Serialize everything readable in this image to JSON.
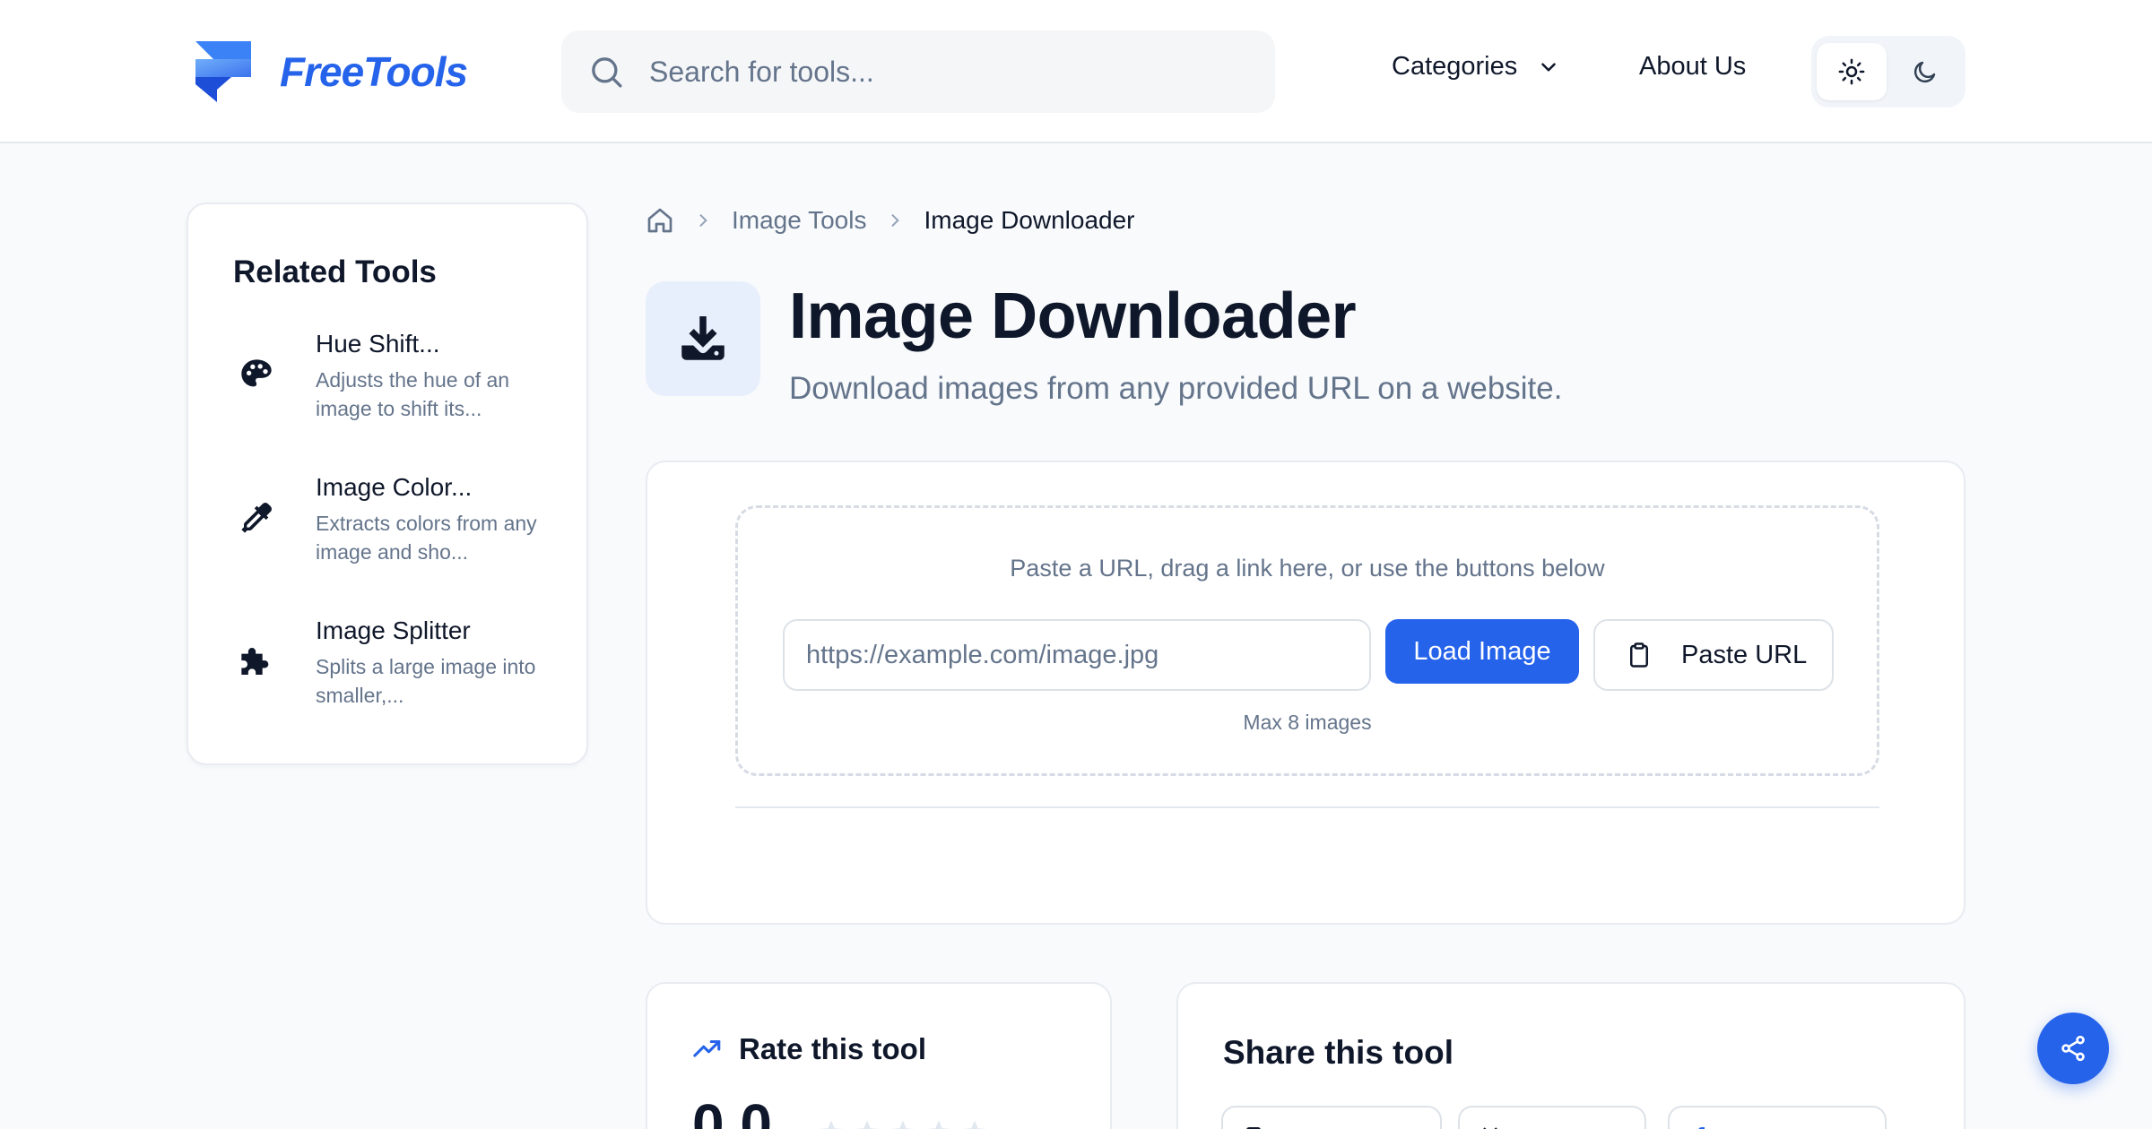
{
  "header": {
    "logo_text": "FreeTools",
    "search": {
      "placeholder": "Search for tools..."
    },
    "nav": {
      "categories": "Categories",
      "about": "About Us"
    },
    "theme": {
      "light_icon": "sun-icon",
      "dark_icon": "moon-icon"
    }
  },
  "sidebar": {
    "title": "Related Tools",
    "items": [
      {
        "name": "Hue Shift...",
        "description": "Adjusts the hue of an image to shift its...",
        "icon": "palette-icon"
      },
      {
        "name": "Image Color...",
        "description": "Extracts colors from any image and sho...",
        "icon": "eyedropper-icon"
      },
      {
        "name": "Image Splitter",
        "description": "Splits a large image into smaller,...",
        "icon": "puzzle-icon"
      }
    ]
  },
  "breadcrumb": {
    "home_icon": "home-icon",
    "items": [
      "Image Tools",
      "Image Downloader"
    ]
  },
  "page": {
    "title": "Image Downloader",
    "subtitle": "Download images from any provided URL on a website.",
    "icon": "download-icon"
  },
  "tool": {
    "drop_hint": "Paste a URL, drag a link here, or use the buttons below",
    "url_placeholder": "https://example.com/image.jpg",
    "url_value": "",
    "load_button": "Load Image",
    "paste_button": "Paste URL",
    "max_note": "Max 8 images"
  },
  "rating": {
    "title": "Rate this tool",
    "score": "0.0"
  },
  "share": {
    "title": "Share this tool"
  },
  "colors": {
    "accent": "#2563eb",
    "text_primary": "#0f172a",
    "text_muted": "#64748b",
    "background": "#f8fafc"
  }
}
